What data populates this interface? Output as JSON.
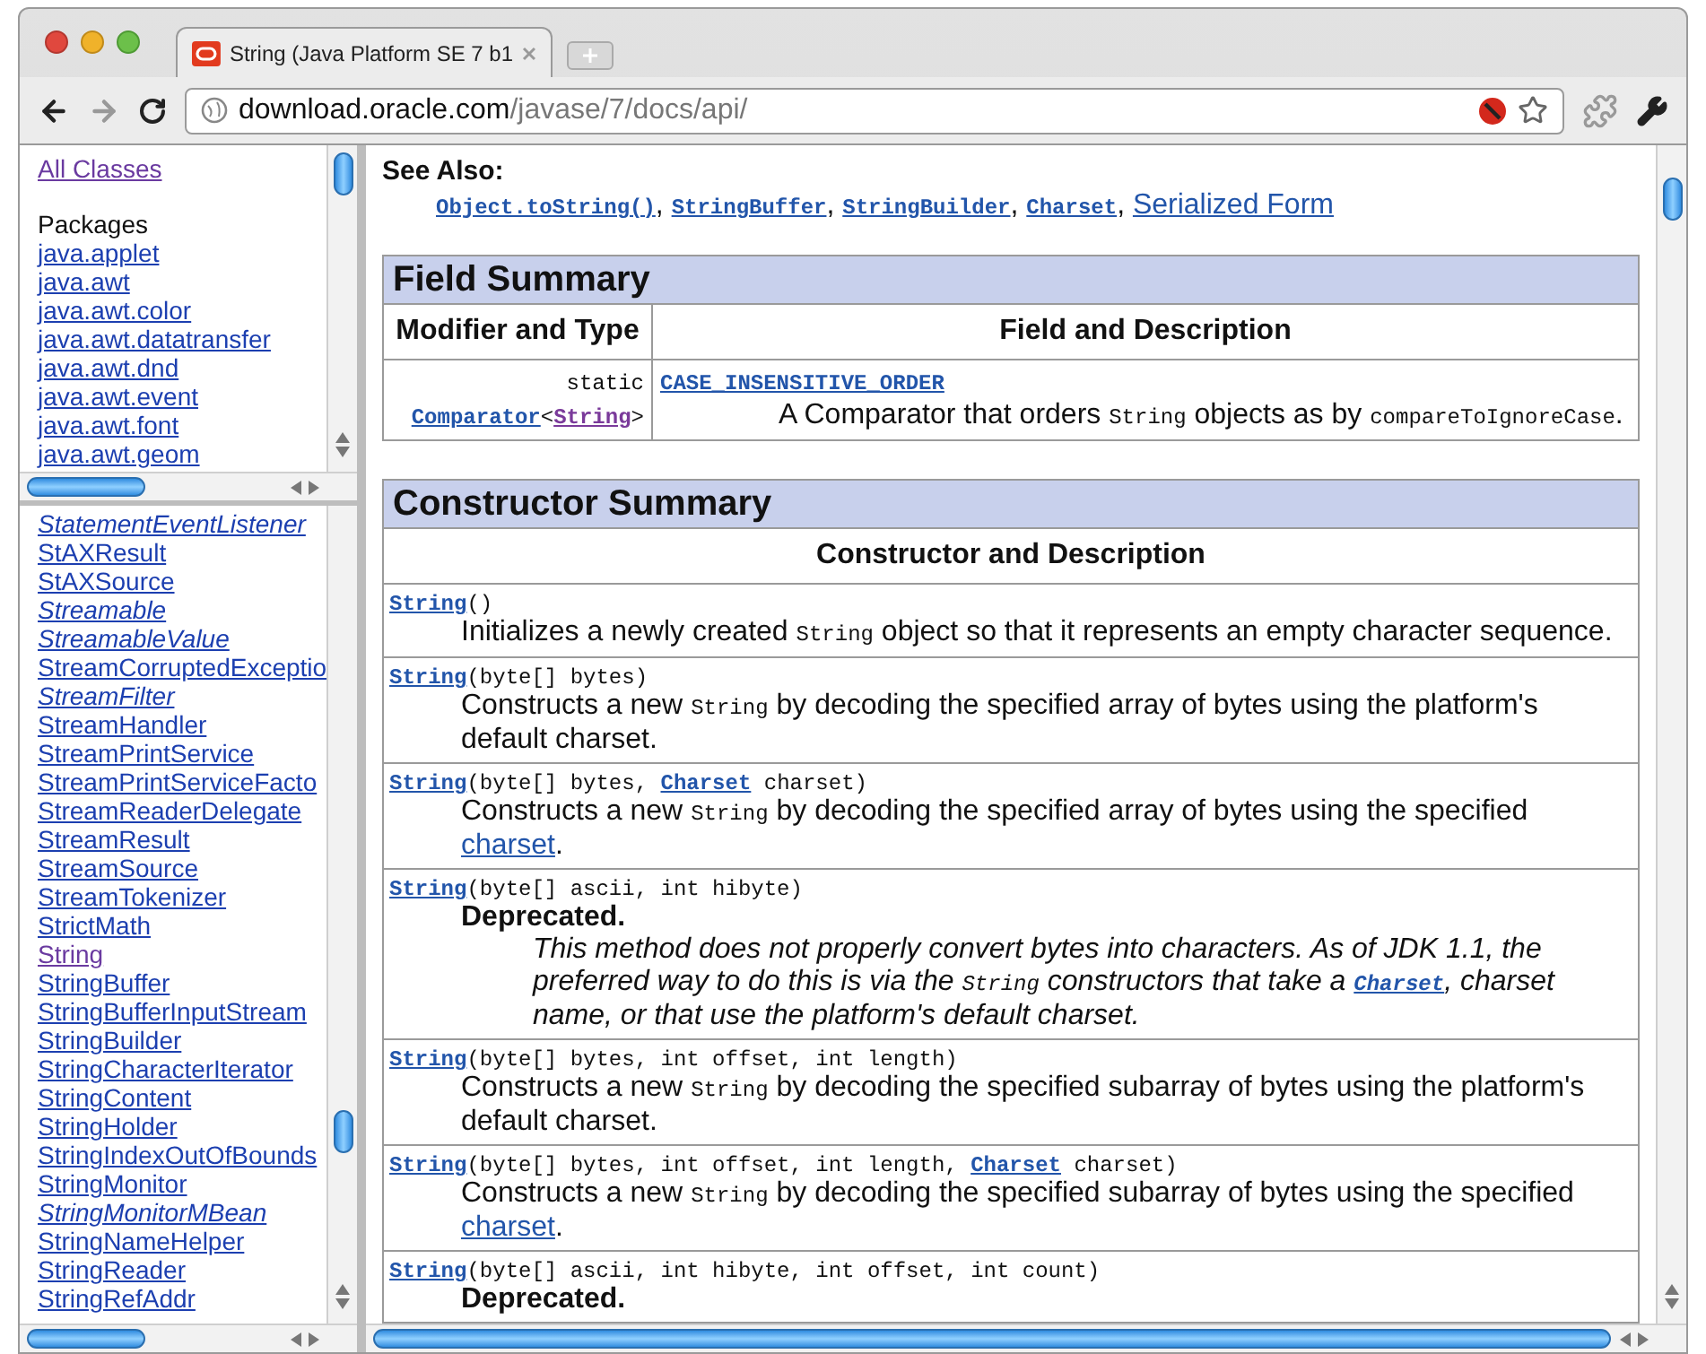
{
  "window": {
    "tab": {
      "title": "String (Java Platform SE 7 b1",
      "selected": true
    },
    "address": {
      "host": "download.oracle.com",
      "path": "/javase/7/docs/api/"
    }
  },
  "sidebar": {
    "all_classes": {
      "label": "All Classes",
      "visited": true
    },
    "packages_heading": "Packages",
    "packages": [
      "java.applet",
      "java.awt",
      "java.awt.color",
      "java.awt.datatransfer",
      "java.awt.dnd",
      "java.awt.event",
      "java.awt.font",
      "java.awt.geom"
    ],
    "classes": [
      {
        "label": "StatementEventListener",
        "kind": "interface",
        "visited": false
      },
      {
        "label": "StAXResult",
        "kind": "class",
        "visited": false
      },
      {
        "label": "StAXSource",
        "kind": "class",
        "visited": false
      },
      {
        "label": "Streamable",
        "kind": "interface",
        "visited": false
      },
      {
        "label": "StreamableValue",
        "kind": "interface",
        "visited": false
      },
      {
        "label": "StreamCorruptedExceptio",
        "kind": "class",
        "visited": false
      },
      {
        "label": "StreamFilter",
        "kind": "interface",
        "visited": false
      },
      {
        "label": "StreamHandler",
        "kind": "class",
        "visited": false
      },
      {
        "label": "StreamPrintService",
        "kind": "class",
        "visited": false
      },
      {
        "label": "StreamPrintServiceFacto",
        "kind": "class",
        "visited": false
      },
      {
        "label": "StreamReaderDelegate",
        "kind": "class",
        "visited": false
      },
      {
        "label": "StreamResult",
        "kind": "class",
        "visited": false
      },
      {
        "label": "StreamSource",
        "kind": "class",
        "visited": false
      },
      {
        "label": "StreamTokenizer",
        "kind": "class",
        "visited": false
      },
      {
        "label": "StrictMath",
        "kind": "class",
        "visited": false
      },
      {
        "label": "String",
        "kind": "class",
        "visited": true
      },
      {
        "label": "StringBuffer",
        "kind": "class",
        "visited": false
      },
      {
        "label": "StringBufferInputStream",
        "kind": "class",
        "visited": false
      },
      {
        "label": "StringBuilder",
        "kind": "class",
        "visited": false
      },
      {
        "label": "StringCharacterIterator",
        "kind": "class",
        "visited": false
      },
      {
        "label": "StringContent",
        "kind": "class",
        "visited": false
      },
      {
        "label": "StringHolder",
        "kind": "class",
        "visited": false
      },
      {
        "label": "StringIndexOutOfBounds",
        "kind": "class",
        "visited": false
      },
      {
        "label": "StringMonitor",
        "kind": "class",
        "visited": false
      },
      {
        "label": "StringMonitorMBean",
        "kind": "interface",
        "visited": false
      },
      {
        "label": "StringNameHelper",
        "kind": "class",
        "visited": false
      },
      {
        "label": "StringReader",
        "kind": "class",
        "visited": false
      },
      {
        "label": "StringRefAddr",
        "kind": "class",
        "visited": false
      }
    ]
  },
  "content": {
    "see_also": {
      "heading": "See Also:",
      "items": [
        {
          "kind": "code_link",
          "text": "Object.toString()"
        },
        {
          "kind": "text",
          "text": ", "
        },
        {
          "kind": "code_link",
          "text": "StringBuffer"
        },
        {
          "kind": "text",
          "text": ", "
        },
        {
          "kind": "code_link",
          "text": "StringBuilder"
        },
        {
          "kind": "text",
          "text": ", "
        },
        {
          "kind": "code_link",
          "text": "Charset"
        },
        {
          "kind": "text",
          "text": ", "
        },
        {
          "kind": "link",
          "text": "Serialized Form"
        }
      ]
    },
    "field_summary": {
      "title": "Field Summary",
      "columns": [
        "Modifier and Type",
        "Field and Description"
      ],
      "rows": [
        {
          "modifier": [
            [
              {
                "kind": "code",
                "text": "static"
              }
            ],
            [
              {
                "kind": "code_link",
                "text": "Comparator"
              },
              {
                "kind": "code",
                "text": "<"
              },
              {
                "kind": "code_link",
                "text": "String",
                "visited": true
              },
              {
                "kind": "code",
                "text": ">"
              }
            ]
          ],
          "name": "CASE_INSENSITIVE_ORDER",
          "description": [
            {
              "kind": "text",
              "text": "A Comparator that orders "
            },
            {
              "kind": "code",
              "text": "String"
            },
            {
              "kind": "text",
              "text": " objects as by "
            },
            {
              "kind": "code",
              "text": "compareToIgnoreCase"
            },
            {
              "kind": "text",
              "text": "."
            }
          ]
        }
      ]
    },
    "constructor_summary": {
      "title": "Constructor Summary",
      "columns": [
        "Constructor and Description"
      ],
      "rows": [
        {
          "kind": "normal",
          "signature": [
            {
              "kind": "code_link",
              "text": "String"
            },
            {
              "kind": "code",
              "text": "()"
            }
          ],
          "description": [
            {
              "kind": "text",
              "text": "Initializes a newly created "
            },
            {
              "kind": "code",
              "text": "String"
            },
            {
              "kind": "text",
              "text": " object so that it represents an empty character sequence."
            }
          ]
        },
        {
          "kind": "normal",
          "signature": [
            {
              "kind": "code_link",
              "text": "String"
            },
            {
              "kind": "code",
              "text": "(byte[] bytes)"
            }
          ],
          "description": [
            {
              "kind": "text",
              "text": "Constructs a new "
            },
            {
              "kind": "code",
              "text": "String"
            },
            {
              "kind": "text",
              "text": " by decoding the specified array of bytes using the platform's default charset."
            }
          ]
        },
        {
          "kind": "normal",
          "signature": [
            {
              "kind": "code_link",
              "text": "String"
            },
            {
              "kind": "code",
              "text": "(byte[] bytes, "
            },
            {
              "kind": "code_link",
              "text": "Charset"
            },
            {
              "kind": "code",
              "text": " charset)"
            }
          ],
          "description": [
            {
              "kind": "text",
              "text": "Constructs a new "
            },
            {
              "kind": "code",
              "text": "String"
            },
            {
              "kind": "text",
              "text": " by decoding the specified array of bytes using the specified "
            },
            {
              "kind": "link",
              "text": "charset"
            },
            {
              "kind": "text",
              "text": "."
            }
          ]
        },
        {
          "kind": "deprecated",
          "signature": [
            {
              "kind": "code_link",
              "text": "String"
            },
            {
              "kind": "code",
              "text": "(byte[] ascii, int hibyte)"
            }
          ],
          "label": "Deprecated.",
          "note": [
            {
              "kind": "text",
              "text": "This method does not properly convert bytes into characters. As of JDK 1.1, the preferred way to do this is via the "
            },
            {
              "kind": "code",
              "text": "String"
            },
            {
              "kind": "text",
              "text": " constructors that take a "
            },
            {
              "kind": "code_link",
              "text": "Charset"
            },
            {
              "kind": "text",
              "text": ", charset name, or that use the platform's default charset."
            }
          ]
        },
        {
          "kind": "normal",
          "signature": [
            {
              "kind": "code_link",
              "text": "String"
            },
            {
              "kind": "code",
              "text": "(byte[] bytes, int offset, int length)"
            }
          ],
          "description": [
            {
              "kind": "text",
              "text": "Constructs a new "
            },
            {
              "kind": "code",
              "text": "String"
            },
            {
              "kind": "text",
              "text": " by decoding the specified subarray of bytes using the platform's default charset."
            }
          ]
        },
        {
          "kind": "normal",
          "signature": [
            {
              "kind": "code_link",
              "text": "String"
            },
            {
              "kind": "code",
              "text": "(byte[] bytes, int offset, int length, "
            },
            {
              "kind": "code_link",
              "text": "Charset"
            },
            {
              "kind": "code",
              "text": " charset)"
            }
          ],
          "description": [
            {
              "kind": "text",
              "text": "Constructs a new "
            },
            {
              "kind": "code",
              "text": "String"
            },
            {
              "kind": "text",
              "text": " by decoding the specified subarray of bytes using the specified "
            },
            {
              "kind": "link",
              "text": "charset"
            },
            {
              "kind": "text",
              "text": "."
            }
          ]
        },
        {
          "kind": "deprecated",
          "signature": [
            {
              "kind": "code_link",
              "text": "String"
            },
            {
              "kind": "code",
              "text": "(byte[] ascii, int hibyte, int offset, int count)"
            }
          ],
          "label": "Deprecated."
        }
      ]
    }
  }
}
